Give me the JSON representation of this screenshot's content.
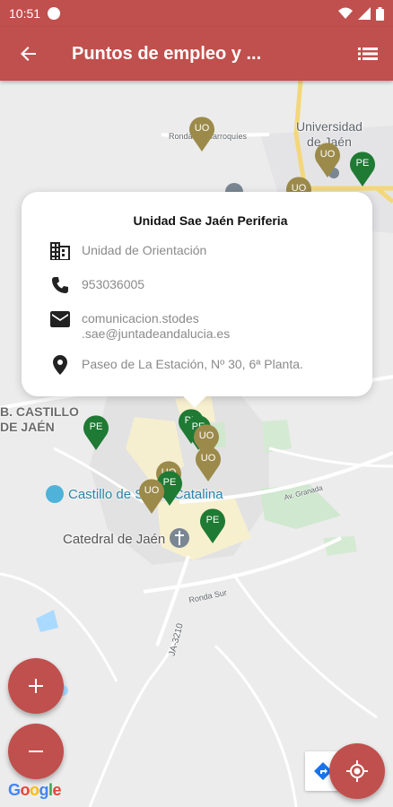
{
  "status": {
    "time": "10:51"
  },
  "appbar": {
    "title": "Puntos de empleo y ..."
  },
  "map": {
    "labels": {
      "universidad_line1": "Universidad",
      "universidad_line2": "de Jaén",
      "ronda": "Ronda de Marroquíes",
      "castillo_area_line1": "B. CASTILLO",
      "castillo_area_line2": "DE JAÉN",
      "castillo_poi": "Castillo de Santa Catalina",
      "catedral": "Catedral de Jaén",
      "ronda_sur": "Ronda Sur",
      "ja3210": "JA-3210",
      "granada": "Av. Granada"
    },
    "markers": [
      {
        "label": "UO",
        "color": "#9c8a4a"
      },
      {
        "label": "UO",
        "color": "#9c8a4a"
      },
      {
        "label": "PE",
        "color": "#1f7a33"
      },
      {
        "label": "UO",
        "color": "#9c8a4a"
      },
      {
        "label": "PE",
        "color": "#1f7a33"
      },
      {
        "label": "PE",
        "color": "#1f7a33"
      },
      {
        "label": "PE",
        "color": "#1f7a33"
      },
      {
        "label": "UO",
        "color": "#9c8a4a"
      },
      {
        "label": "UO",
        "color": "#9c8a4a"
      },
      {
        "label": "UO",
        "color": "#9c8a4a"
      },
      {
        "label": "PE",
        "color": "#1f7a33"
      },
      {
        "label": "UO",
        "color": "#9c8a4a"
      },
      {
        "label": "PE",
        "color": "#1f7a33"
      }
    ]
  },
  "card": {
    "title": "Unidad Sae Jaén Periferia",
    "type": "Unidad de Orientación",
    "phone": "953036005",
    "email_line1": "comunicacion.stodes",
    "email_line2": ".sae@juntadeandalucia.es",
    "address": "Paseo de La Estación, Nº 30, 6ª Planta."
  },
  "google_logo": {
    "G": "G",
    "o1": "o",
    "o2": "o",
    "g": "g",
    "l": "l",
    "e": "e"
  },
  "colors": {
    "primary": "#c0504d",
    "uo_marker": "#9c8a4a",
    "pe_marker": "#1f7a33"
  },
  "icons": {
    "back": "arrow-back-icon",
    "list": "list-icon",
    "building": "building-icon",
    "phone": "phone-icon",
    "email": "email-icon",
    "location": "location-pin-icon",
    "zoom_in": "plus-icon",
    "zoom_out": "minus-icon",
    "my_location": "my-location-icon"
  }
}
